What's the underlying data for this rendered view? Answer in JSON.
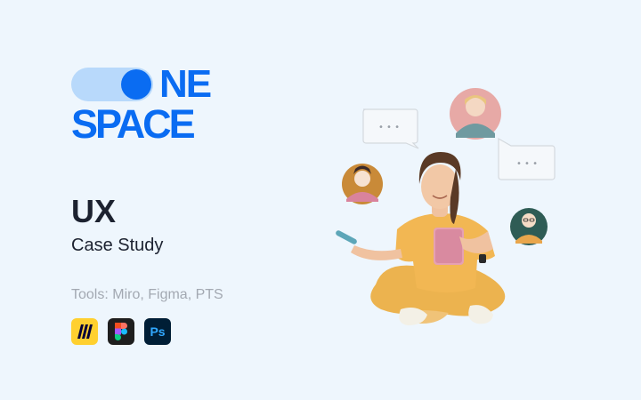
{
  "logo": {
    "line1": "NE",
    "line2": "SPACE"
  },
  "title": "UX",
  "subtitle": "Case Study",
  "tools_text": "Tools: Miro, Figma, PTS",
  "tool_icons": [
    {
      "name": "miro-icon"
    },
    {
      "name": "figma-icon"
    },
    {
      "name": "photoshop-icon",
      "label": "Ps"
    }
  ],
  "chat_bubbles": [
    "• • •",
    "• • •"
  ],
  "colors": {
    "background": "#eef6fd",
    "brand": "#0a6cf2",
    "brand_light": "#b8d9fb",
    "title": "#1c2230",
    "muted": "#a3a9b2"
  }
}
